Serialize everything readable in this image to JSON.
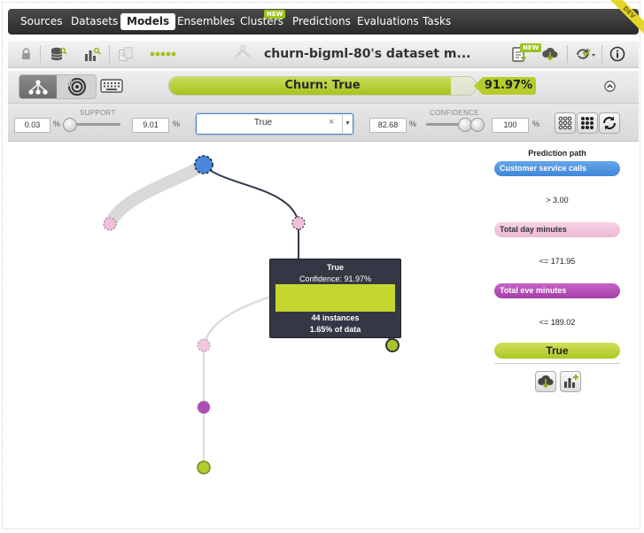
{
  "nav": {
    "items": [
      {
        "label": "Sources"
      },
      {
        "label": "Datasets"
      },
      {
        "label": "Models"
      },
      {
        "label": "Ensembles"
      },
      {
        "label": "Clusters",
        "badge": "NEW"
      },
      {
        "label": "Predictions"
      },
      {
        "label": "Evaluations"
      },
      {
        "label": "Tasks"
      }
    ],
    "active": "Models",
    "ribbon": "DEV"
  },
  "toolbar": {
    "title": "churn-bigml-80's dataset m...",
    "new_badge": "NEW",
    "icons": [
      "lock-icon",
      "dataset-search-icon",
      "chart-search-icon",
      "document-icon",
      "dots-icon",
      "tree-icon",
      "clipboard-download-icon",
      "cloud-download-icon",
      "refresh-options-icon",
      "info-icon"
    ]
  },
  "objective": {
    "label": "Churn: True",
    "confidence_text": "91.97%",
    "confidence_value": 0.9197,
    "accent": "#b5cc2c"
  },
  "filters": {
    "support_label": "SUPPORT",
    "support_min": "0.03",
    "support_max": "9.01",
    "confidence_label": "CONFIDENCE",
    "confidence_min": "82.68",
    "confidence_max": "100",
    "unit": "%",
    "class_value": "True",
    "clear_symbol": "×"
  },
  "tooltip": {
    "title": "True",
    "confidence": "Confidence: 91.97%",
    "instances": "44 instances",
    "percent_data": "1.65% of data"
  },
  "prediction_path": {
    "title": "Prediction path",
    "steps": [
      {
        "field": "Customer service calls",
        "condition": "> 3.00",
        "color": "#4e95e0"
      },
      {
        "field": "Total day minutes",
        "condition": "<= 171.95",
        "color": "#f0bfd9"
      },
      {
        "field": "Total eve minutes",
        "condition": "<= 189.02",
        "color": "#b24cb5"
      }
    ],
    "result": "True"
  }
}
